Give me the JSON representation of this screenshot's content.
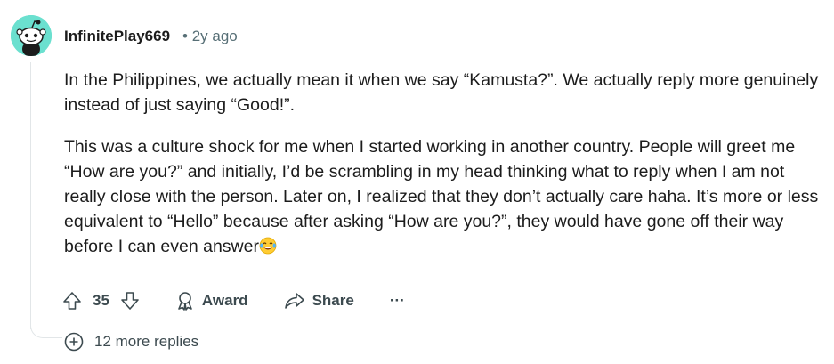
{
  "comment": {
    "username": "InfinitePlay669",
    "separator": "•",
    "time_ago": "2y ago",
    "paragraphs": [
      "In the Philippines, we actually mean it when we say “Kamusta?”. We actually reply more genuinely instead of just saying “Good!”.",
      "This was a culture shock for me when I started working in another country. People will greet me “How are you?” and initially, I’d be scrambling in my head thinking what to reply when I am not really close with the person. Later on, I realized that they don’t actually care haha. It’s more or less equivalent to “Hello” because after asking “How are you?”, they would have gone off their way before I can even answer"
    ],
    "emoji_icon": "laughing-with-tears-emoji"
  },
  "actions": {
    "vote_count": "35",
    "award_label": "Award",
    "share_label": "Share",
    "more_label": "···"
  },
  "replies": {
    "label": "12 more replies"
  },
  "colors": {
    "avatar_bg": "#6be0cf",
    "meta_text": "#576f76",
    "action_text": "#3c4a4f",
    "thread_line": "#e2e6e8"
  }
}
